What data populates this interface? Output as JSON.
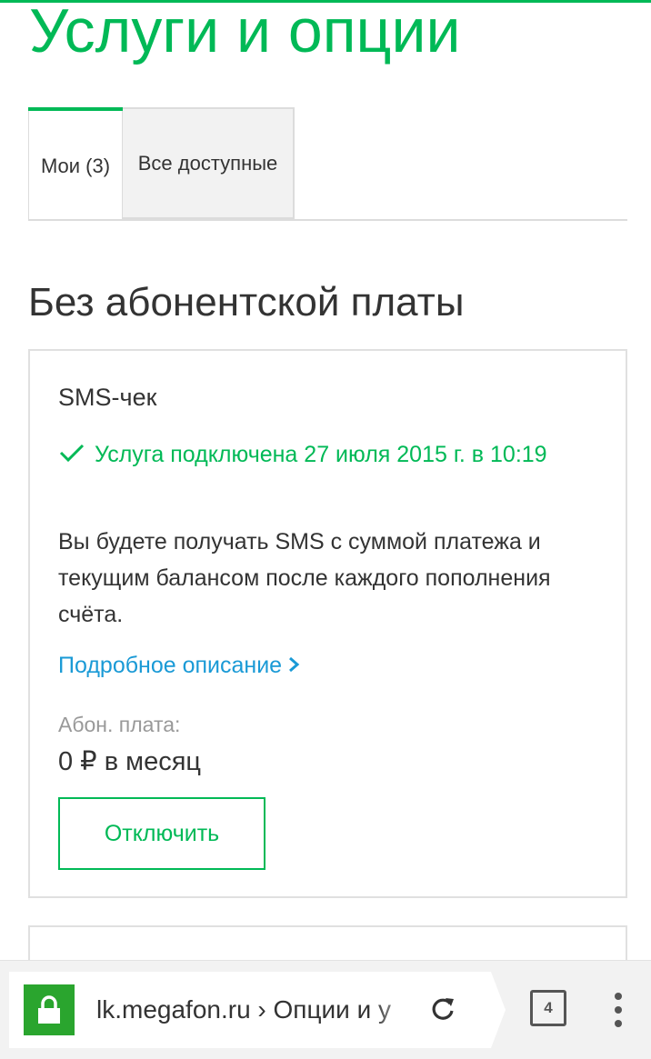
{
  "page": {
    "title": "Услуги и опции",
    "tabs": [
      {
        "label": "Мои (3)",
        "active": true
      },
      {
        "label": "Все доступные",
        "active": false
      }
    ],
    "section_title": "Без абонентской платы"
  },
  "service": {
    "name": "SMS-чек",
    "status_icon": "check-icon",
    "status": "Услуга подключена 27 июля 2015 г. в 10:19",
    "description": "Вы будете получать SMS с суммой платежа и текущим балансом после каждого пополнения счёта.",
    "details_link": "Подробное описание",
    "fee_label": "Абон. плата:",
    "fee_value": "0 ₽ в месяц",
    "disable_button": "Отключить"
  },
  "browser": {
    "url": "lk.megafon.ru › Опции и у",
    "tab_count": "4",
    "secure_icon": "lock-icon"
  },
  "colors": {
    "brand_green": "#00b956",
    "link_blue": "#1a9ad6",
    "lock_green": "#2aa52e"
  }
}
